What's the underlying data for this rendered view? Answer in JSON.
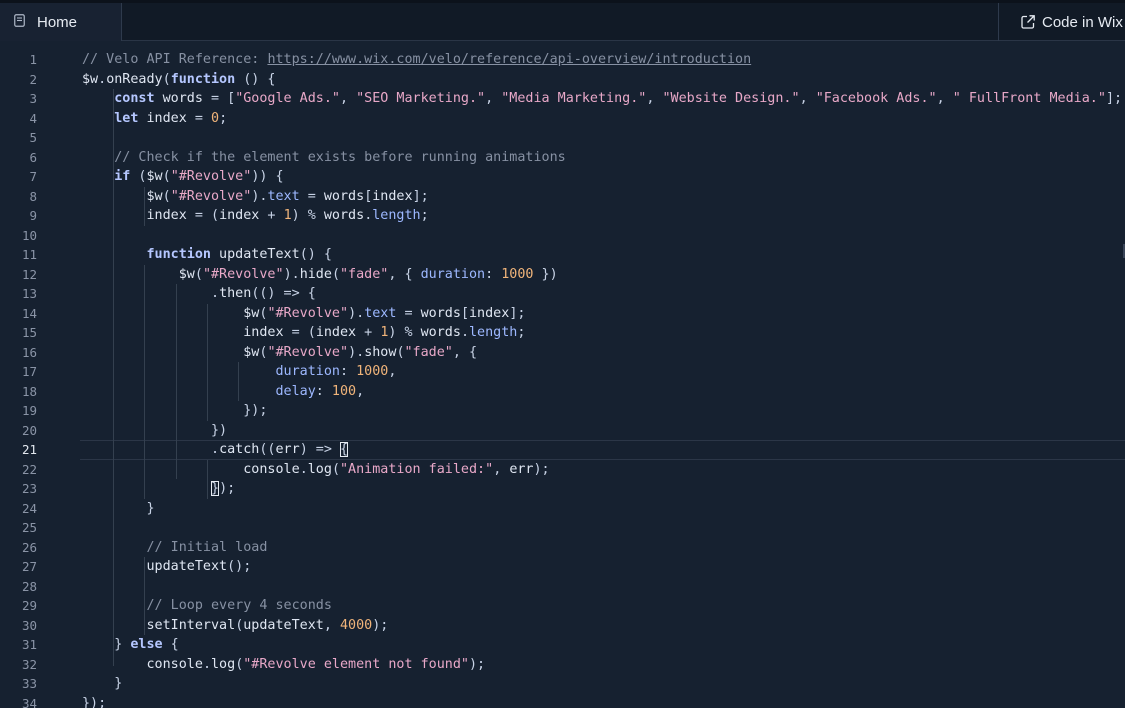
{
  "tabs": {
    "active_label": "Home",
    "code_in_wix_label": "Code in Wix"
  },
  "editor": {
    "active_line": 21,
    "lines": [
      {
        "n": "1",
        "tokens": [
          [
            "t-comment",
            "// Velo API Reference: "
          ],
          [
            "t-link",
            "https://www.wix.com/velo/reference/api-overview/introduction"
          ]
        ]
      },
      {
        "n": "2",
        "tokens": [
          [
            "t-var",
            "$w"
          ],
          [
            "t-punc",
            "."
          ],
          [
            "t-fn",
            "onReady"
          ],
          [
            "t-punc",
            "("
          ],
          [
            "t-kw",
            "function"
          ],
          [
            "t-punc",
            " () {"
          ]
        ]
      },
      {
        "n": "3",
        "tokens": [
          [
            "t-punc",
            "    "
          ],
          [
            "t-kw",
            "const"
          ],
          [
            "t-var",
            " words "
          ],
          [
            "t-punc",
            "= ["
          ],
          [
            "t-str",
            "\"Google Ads.\""
          ],
          [
            "t-punc",
            ", "
          ],
          [
            "t-str",
            "\"SEO Marketing.\""
          ],
          [
            "t-punc",
            ", "
          ],
          [
            "t-str",
            "\"Media Marketing.\""
          ],
          [
            "t-punc",
            ", "
          ],
          [
            "t-str",
            "\"Website Design.\""
          ],
          [
            "t-punc",
            ", "
          ],
          [
            "t-str",
            "\"Facebook Ads.\""
          ],
          [
            "t-punc",
            ", "
          ],
          [
            "t-str",
            "\" FullFront Media.\""
          ],
          [
            "t-punc",
            "];"
          ]
        ]
      },
      {
        "n": "4",
        "tokens": [
          [
            "t-punc",
            "    "
          ],
          [
            "t-kw",
            "let"
          ],
          [
            "t-var",
            " index "
          ],
          [
            "t-punc",
            "= "
          ],
          [
            "t-num",
            "0"
          ],
          [
            "t-punc",
            ";"
          ]
        ]
      },
      {
        "n": "5",
        "tokens": []
      },
      {
        "n": "6",
        "tokens": [
          [
            "t-comment",
            "    // Check if the element exists before running animations"
          ]
        ]
      },
      {
        "n": "7",
        "tokens": [
          [
            "t-punc",
            "    "
          ],
          [
            "t-kw",
            "if"
          ],
          [
            "t-punc",
            " ("
          ],
          [
            "t-fn",
            "$w"
          ],
          [
            "t-punc",
            "("
          ],
          [
            "t-str",
            "\"#Revolve\""
          ],
          [
            "t-punc",
            ")) {"
          ]
        ]
      },
      {
        "n": "8",
        "tokens": [
          [
            "t-punc",
            "        "
          ],
          [
            "t-fn",
            "$w"
          ],
          [
            "t-punc",
            "("
          ],
          [
            "t-str",
            "\"#Revolve\""
          ],
          [
            "t-punc",
            ")."
          ],
          [
            "t-prop",
            "text"
          ],
          [
            "t-punc",
            " = "
          ],
          [
            "t-var",
            "words"
          ],
          [
            "t-punc",
            "["
          ],
          [
            "t-var",
            "index"
          ],
          [
            "t-punc",
            "];"
          ]
        ]
      },
      {
        "n": "9",
        "tokens": [
          [
            "t-punc",
            "        "
          ],
          [
            "t-var",
            "index"
          ],
          [
            "t-punc",
            " = ("
          ],
          [
            "t-var",
            "index"
          ],
          [
            "t-punc",
            " + "
          ],
          [
            "t-num",
            "1"
          ],
          [
            "t-punc",
            ") % "
          ],
          [
            "t-var",
            "words"
          ],
          [
            "t-punc",
            "."
          ],
          [
            "t-prop",
            "length"
          ],
          [
            "t-punc",
            ";"
          ]
        ]
      },
      {
        "n": "10",
        "tokens": []
      },
      {
        "n": "11",
        "tokens": [
          [
            "t-punc",
            "        "
          ],
          [
            "t-kw",
            "function"
          ],
          [
            "t-fn",
            " updateText"
          ],
          [
            "t-punc",
            "() {"
          ]
        ]
      },
      {
        "n": "12",
        "tokens": [
          [
            "t-punc",
            "            "
          ],
          [
            "t-fn",
            "$w"
          ],
          [
            "t-punc",
            "("
          ],
          [
            "t-str",
            "\"#Revolve\""
          ],
          [
            "t-punc",
            ")."
          ],
          [
            "t-fn",
            "hide"
          ],
          [
            "t-punc",
            "("
          ],
          [
            "t-str",
            "\"fade\""
          ],
          [
            "t-punc",
            ", { "
          ],
          [
            "t-prop",
            "duration"
          ],
          [
            "t-punc",
            ": "
          ],
          [
            "t-num",
            "1000"
          ],
          [
            "t-punc",
            " })"
          ]
        ]
      },
      {
        "n": "13",
        "tokens": [
          [
            "t-punc",
            "                ."
          ],
          [
            "t-fn",
            "then"
          ],
          [
            "t-punc",
            "(() => {"
          ]
        ]
      },
      {
        "n": "14",
        "tokens": [
          [
            "t-punc",
            "                    "
          ],
          [
            "t-fn",
            "$w"
          ],
          [
            "t-punc",
            "("
          ],
          [
            "t-str",
            "\"#Revolve\""
          ],
          [
            "t-punc",
            ")."
          ],
          [
            "t-prop",
            "text"
          ],
          [
            "t-punc",
            " = "
          ],
          [
            "t-var",
            "words"
          ],
          [
            "t-punc",
            "["
          ],
          [
            "t-var",
            "index"
          ],
          [
            "t-punc",
            "];"
          ]
        ]
      },
      {
        "n": "15",
        "tokens": [
          [
            "t-punc",
            "                    "
          ],
          [
            "t-var",
            "index"
          ],
          [
            "t-punc",
            " = ("
          ],
          [
            "t-var",
            "index"
          ],
          [
            "t-punc",
            " + "
          ],
          [
            "t-num",
            "1"
          ],
          [
            "t-punc",
            ") % "
          ],
          [
            "t-var",
            "words"
          ],
          [
            "t-punc",
            "."
          ],
          [
            "t-prop",
            "length"
          ],
          [
            "t-punc",
            ";"
          ]
        ]
      },
      {
        "n": "16",
        "tokens": [
          [
            "t-punc",
            "                    "
          ],
          [
            "t-fn",
            "$w"
          ],
          [
            "t-punc",
            "("
          ],
          [
            "t-str",
            "\"#Revolve\""
          ],
          [
            "t-punc",
            ")."
          ],
          [
            "t-fn",
            "show"
          ],
          [
            "t-punc",
            "("
          ],
          [
            "t-str",
            "\"fade\""
          ],
          [
            "t-punc",
            ", {"
          ]
        ]
      },
      {
        "n": "17",
        "tokens": [
          [
            "t-punc",
            "                        "
          ],
          [
            "t-prop",
            "duration"
          ],
          [
            "t-punc",
            ": "
          ],
          [
            "t-num",
            "1000"
          ],
          [
            "t-punc",
            ","
          ]
        ]
      },
      {
        "n": "18",
        "tokens": [
          [
            "t-punc",
            "                        "
          ],
          [
            "t-prop",
            "delay"
          ],
          [
            "t-punc",
            ": "
          ],
          [
            "t-num",
            "100"
          ],
          [
            "t-punc",
            ","
          ]
        ]
      },
      {
        "n": "19",
        "tokens": [
          [
            "t-punc",
            "                    });"
          ]
        ]
      },
      {
        "n": "20",
        "tokens": [
          [
            "t-punc",
            "                })"
          ]
        ]
      },
      {
        "n": "21",
        "tokens": [
          [
            "t-punc",
            "                ."
          ],
          [
            "t-fn",
            "catch"
          ],
          [
            "t-punc",
            "(("
          ],
          [
            "t-var",
            "err"
          ],
          [
            "t-punc",
            ") => "
          ],
          [
            "cursor-box",
            "{"
          ]
        ]
      },
      {
        "n": "22",
        "tokens": [
          [
            "t-punc",
            "                    "
          ],
          [
            "t-fn",
            "console"
          ],
          [
            "t-punc",
            "."
          ],
          [
            "t-fn",
            "log"
          ],
          [
            "t-punc",
            "("
          ],
          [
            "t-str",
            "\"Animation failed:\""
          ],
          [
            "t-punc",
            ", "
          ],
          [
            "t-var",
            "err"
          ],
          [
            "t-punc",
            ");"
          ]
        ]
      },
      {
        "n": "23",
        "tokens": [
          [
            "t-punc",
            "                "
          ],
          [
            "cursor-box",
            "}"
          ],
          [
            "t-punc",
            ");"
          ]
        ]
      },
      {
        "n": "24",
        "tokens": [
          [
            "t-punc",
            "        }"
          ]
        ]
      },
      {
        "n": "25",
        "tokens": []
      },
      {
        "n": "26",
        "tokens": [
          [
            "t-comment",
            "        // Initial load"
          ]
        ]
      },
      {
        "n": "27",
        "tokens": [
          [
            "t-punc",
            "        "
          ],
          [
            "t-fn",
            "updateText"
          ],
          [
            "t-punc",
            "();"
          ]
        ]
      },
      {
        "n": "28",
        "tokens": []
      },
      {
        "n": "29",
        "tokens": [
          [
            "t-comment",
            "        // Loop every 4 seconds"
          ]
        ]
      },
      {
        "n": "30",
        "tokens": [
          [
            "t-punc",
            "        "
          ],
          [
            "t-fn",
            "setInterval"
          ],
          [
            "t-punc",
            "("
          ],
          [
            "t-var",
            "updateText"
          ],
          [
            "t-punc",
            ", "
          ],
          [
            "t-num",
            "4000"
          ],
          [
            "t-punc",
            ");"
          ]
        ]
      },
      {
        "n": "31",
        "tokens": [
          [
            "t-punc",
            "    } "
          ],
          [
            "t-kw",
            "else"
          ],
          [
            "t-punc",
            " {"
          ]
        ]
      },
      {
        "n": "32",
        "tokens": [
          [
            "t-punc",
            "        "
          ],
          [
            "t-fn",
            "console"
          ],
          [
            "t-punc",
            "."
          ],
          [
            "t-fn",
            "log"
          ],
          [
            "t-punc",
            "("
          ],
          [
            "t-str",
            "\"#Revolve element not found\""
          ],
          [
            "t-punc",
            ");"
          ]
        ]
      },
      {
        "n": "33",
        "tokens": [
          [
            "t-punc",
            "    }"
          ]
        ]
      },
      {
        "n": "34",
        "tokens": [
          [
            "t-punc",
            "});"
          ]
        ]
      }
    ]
  }
}
